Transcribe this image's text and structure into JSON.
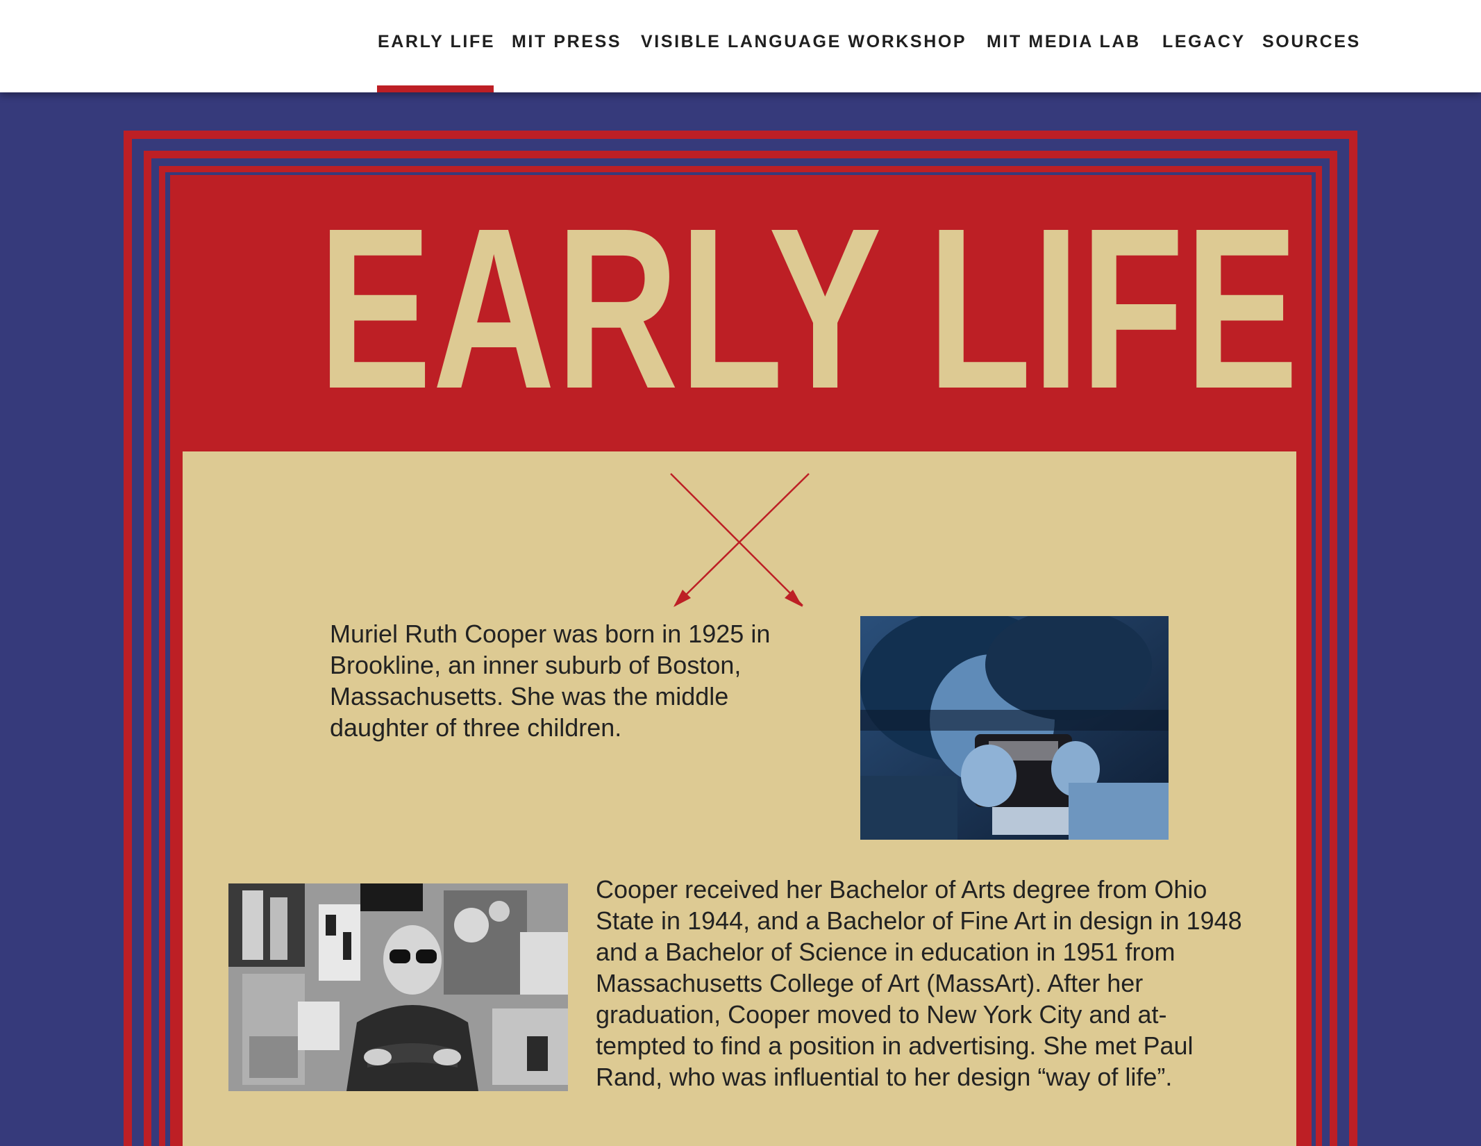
{
  "nav": {
    "items": [
      {
        "label": "EARLY LIFE",
        "active": true
      },
      {
        "label": "MIT PRESS"
      },
      {
        "label": "VISIBLE LANGUAGE WORKSHOP"
      },
      {
        "label": "MIT MEDIA LAB"
      },
      {
        "label": "LEGACY"
      },
      {
        "label": "SOURCES"
      }
    ]
  },
  "poster": {
    "title": "EARLY LIFE",
    "colors": {
      "red": "#bd1f25",
      "blue": "#363a7b",
      "tan": "#ddca93"
    },
    "paragraph_1": "Muriel Ruth Cooper was born in 1925 in Brookline, an inner suburb of Boston, Massachusetts. She was the middle daughter of three children.",
    "paragraph_2": "Cooper received her Bachelor of Arts degree from Ohio State in 1944, and a Bachelor of Fine Art in design in 1948 and a Bachelor of Science in education in 1951 from Massachusetts College of Art (MassArt). After her graduation, Cooper moved to New York City and at-tempted to find a position in advertising. She met Paul Rand, who was influential to her design “way of life”."
  }
}
